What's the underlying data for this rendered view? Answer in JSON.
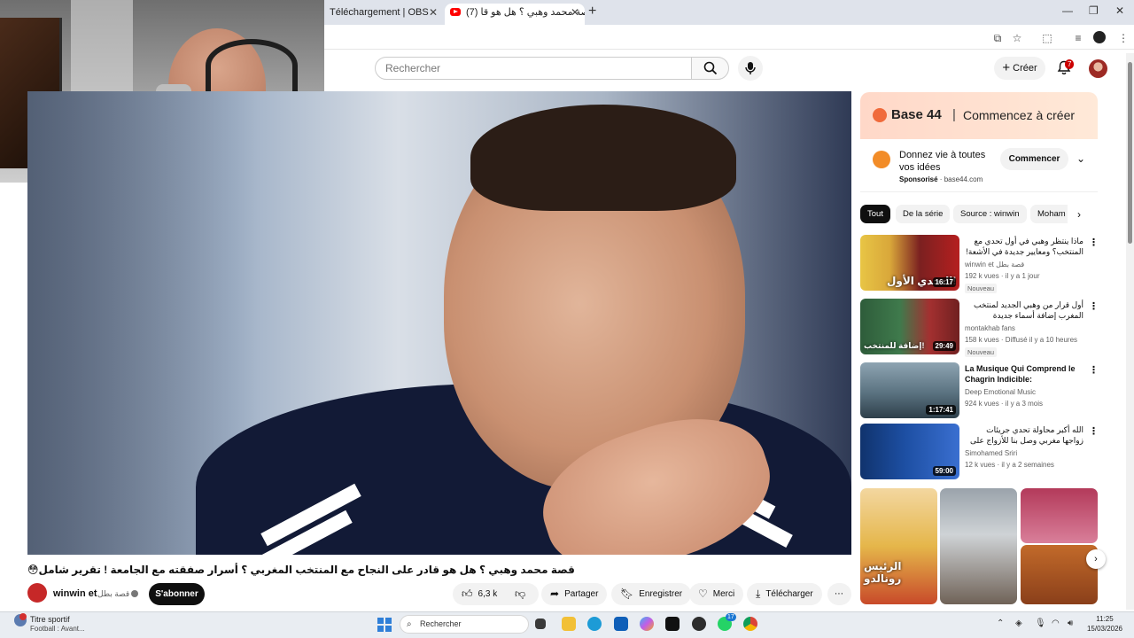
{
  "browser": {
    "tabs": [
      {
        "label": "Téléchargement | OBS"
      },
      {
        "label": "(7) قصة محمد وهبي ؟ هل هو قا"
      }
    ],
    "new_tab": "+",
    "window_controls": [
      "—",
      "❐",
      "✕"
    ]
  },
  "yt_header": {
    "search_placeholder": "Rechercher",
    "create_label": "Créer",
    "notifications_count": "7"
  },
  "video": {
    "title": "قصة محمد وهبي ؟ هل هو قادر على النجاح مع المنتخب المغربي ؟ أسرار صفقته مع الجامعة ! تقرير شامل😳",
    "channel_name": "winwin et",
    "channel_name_ar": "قصة بطل",
    "subscribe_label": "S'abonner",
    "likes": "6,3 k",
    "actions": {
      "share": "Partager",
      "save": "Enregistrer",
      "thanks": "Merci",
      "download": "Télécharger"
    }
  },
  "ad": {
    "brand": "Base 44",
    "separator": "|",
    "tagline": "Commencez à créer",
    "text": "Donnez vie à toutes vos idées",
    "sponsored_label": "Sponsorisé",
    "domain": "base44.com",
    "cta": "Commencer"
  },
  "chips": [
    "Tout",
    "De la série",
    "Source : winwin",
    "Moham"
  ],
  "recommendations": [
    {
      "title": "ماذا ينتظر وهبي في أول تحدي مع المنتخب؟ ومعايير جديدة في الأشعة! 🔥",
      "channel": "winwin et قصة بطل",
      "meta": "192 k vues · il y a 1 jour",
      "duration": "16:17",
      "badge": "Nouveau",
      "thumb_text": "التحدي الأول!"
    },
    {
      "title": "أول قرار من وهبي الجديد لمنتخب المغرب إضافة أسماء جديدة للمنتخب",
      "channel": "montakhab fans",
      "meta": "158 k vues · Diffusé il y a 10 heures",
      "duration": "29:49",
      "badge": "Nouveau",
      "thumb_text": "إضافة للمنتخب!"
    },
    {
      "title": "La Musique Qui Comprend le Chagrin Indicible: Instrumental...",
      "channel": "Deep Emotional Music",
      "meta": "924 k vues · il y a 3 mois",
      "duration": "1:17:41",
      "badge": "",
      "thumb_text": ""
    },
    {
      "title": "الله أكبر محاولة تحدي جريئات زواجها مغربي وصل بنا للأزواج على المغرب وطالبات...",
      "channel": "Simohamed Sriri",
      "meta": "12 k vues · il y a 2 semaines",
      "duration": "59:00",
      "badge": "",
      "thumb_text": ""
    }
  ],
  "shorts_thumb_text": [
    "الرئيس رونالدو"
  ],
  "taskbar": {
    "widget_title": "Titre sportif",
    "widget_sub": "Football : Avant...",
    "search_label": "Rechercher",
    "time": "11:25",
    "date": "15/03/2026",
    "whatsapp_badge": "17"
  },
  "icons": {
    "search": "search-icon",
    "mic": "mic-icon",
    "bell": "bell-icon",
    "like": "thumbs-up-icon",
    "dislike": "thumbs-down-icon",
    "share": "share-icon",
    "save": "bookmark-icon",
    "thanks": "heart-dollar-icon",
    "download": "download-icon"
  },
  "colors": {
    "youtube_red": "#ff0000",
    "subscribe_bg": "#0f0f0f",
    "chip_active": "#0f0f0f",
    "ad_accent": "#f06a3b"
  }
}
